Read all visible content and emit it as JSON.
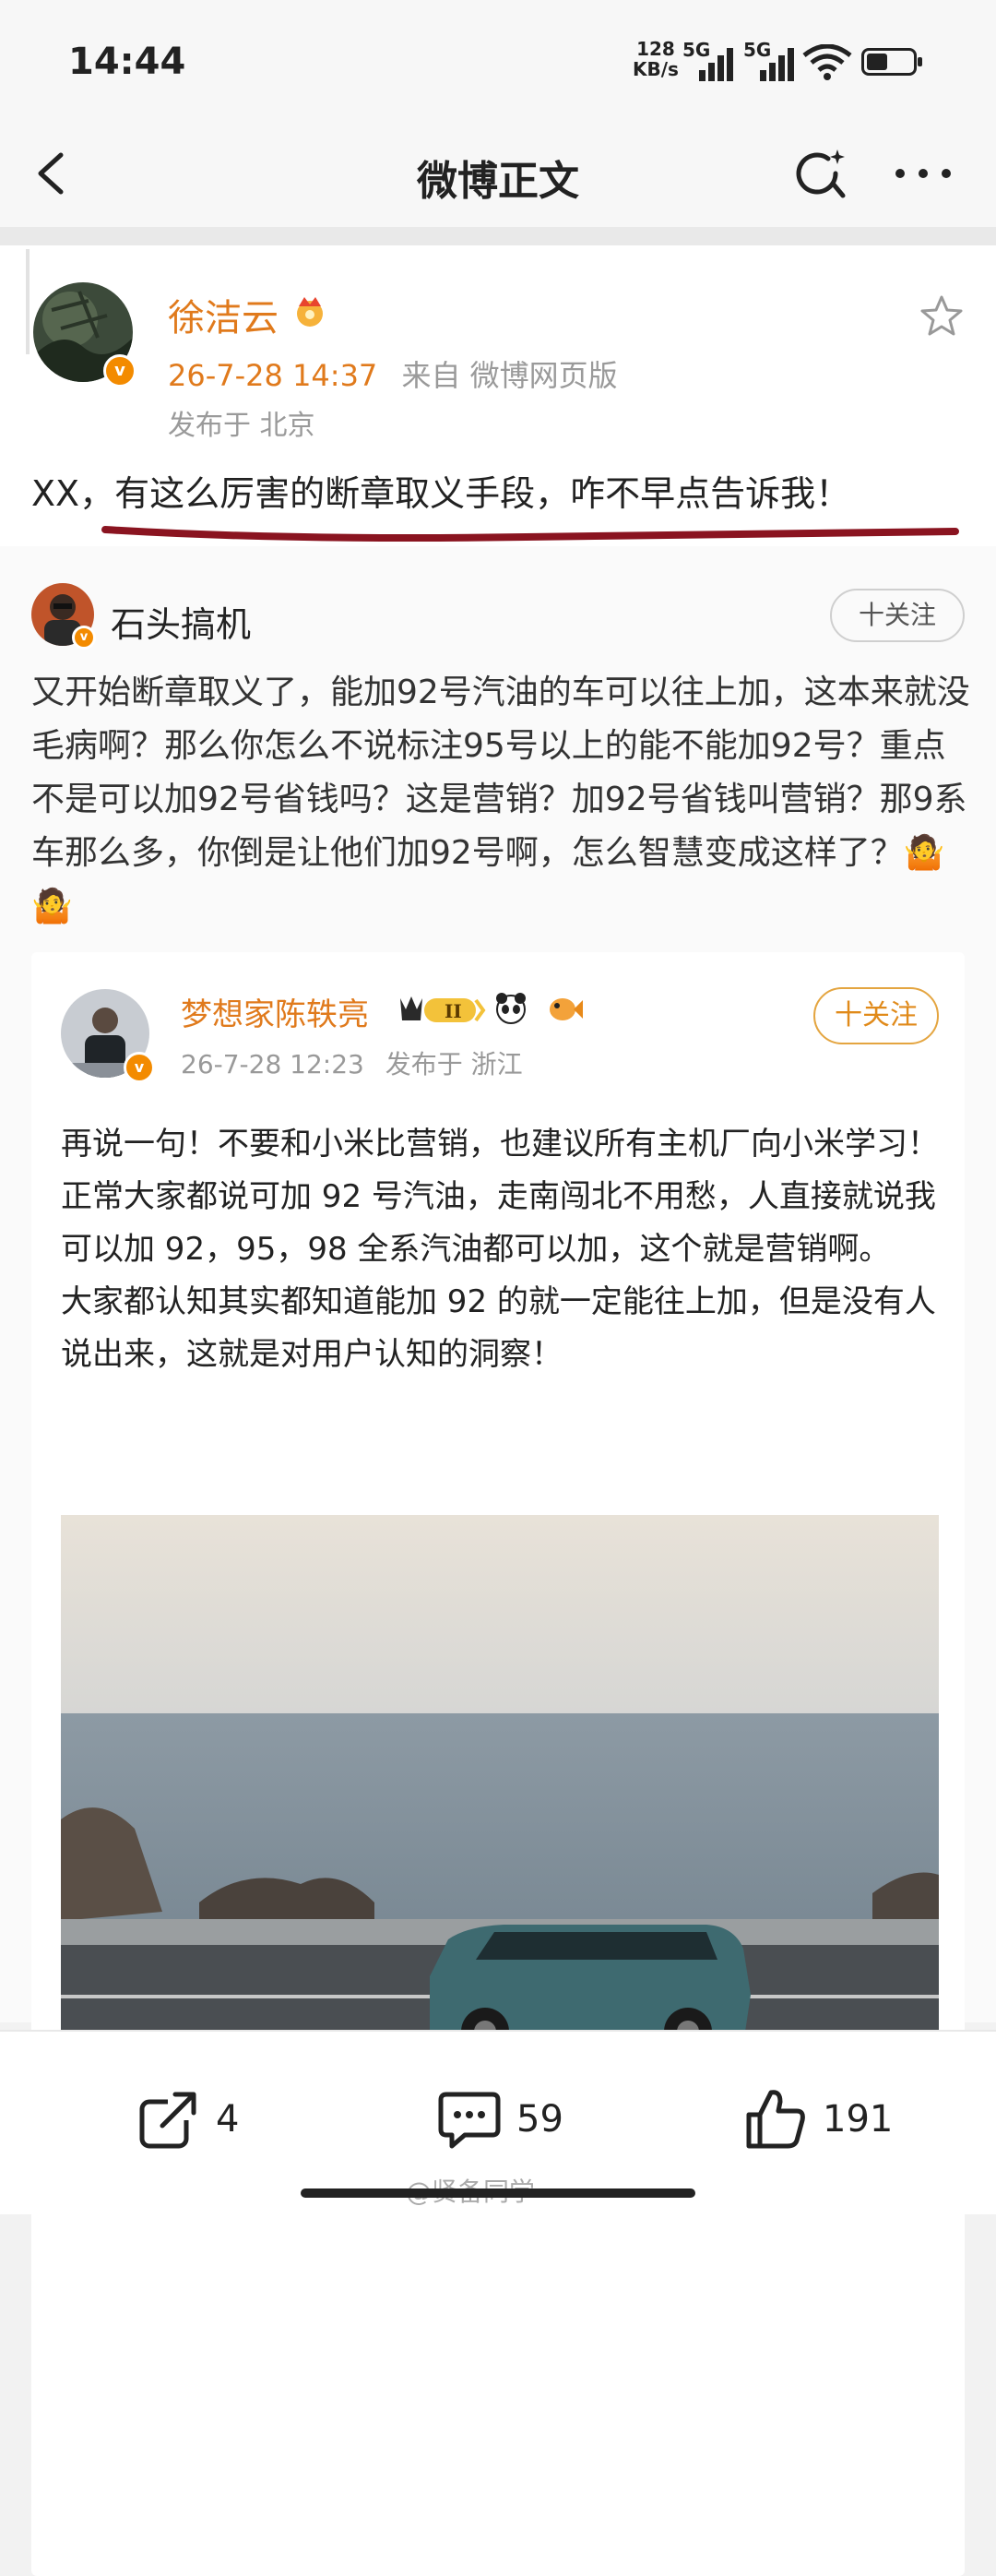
{
  "statusbar": {
    "time": "14:44",
    "speed_value": "128",
    "speed_unit": "KB/s",
    "sim1_label": "5G",
    "sim2_label": "5G"
  },
  "nav": {
    "title": "微博正文"
  },
  "post": {
    "author": "徐洁云",
    "time": "26-7-28 14:37",
    "source": "来自 微博网页版",
    "location": "发布于 北京",
    "content_prefix": "XX，",
    "content_highlight": "有这么厉害的断章取义手段，咋不早点告诉我！"
  },
  "comment": {
    "author": "石头搞机",
    "follow_label": "十关注",
    "text": "又开始断章取义了，能加92号汽油的车可以往上加，这本来就没毛病啊？那么你怎么不说标注95号以上的能不能加92号？重点不是可以加92号省钱吗？这是营销？加92号省钱叫营销？那9系车那么多，你倒是让他们加92号啊，怎么智慧变成这样了？🤷🤷"
  },
  "quoted": {
    "author": "梦想家陈轶亮",
    "level_badge": "II",
    "time": "26-7-28 12:23",
    "location": "发布于 浙江",
    "follow_label": "十关注",
    "paragraphs": [
      "再说一句！不要和小米比营销，也建议所有主机厂向小米学习！",
      "正常大家都说可加 92 号汽油，走南闯北不用愁，人直接就说我可以加 92，95，98 全系汽油都可以加，这个就是营销啊。",
      "大家都认知其实都知道能加 92 的就一定能往上加，但是没有人说出来，这就是对用户认知的洞察！"
    ]
  },
  "actions": {
    "repost_count": "4",
    "comment_count": "59",
    "like_count": "191"
  },
  "watermark": "@贤备同学",
  "colors": {
    "orange": "#e07a1c",
    "underline": "#8a1420",
    "badge": "#f38b00"
  }
}
